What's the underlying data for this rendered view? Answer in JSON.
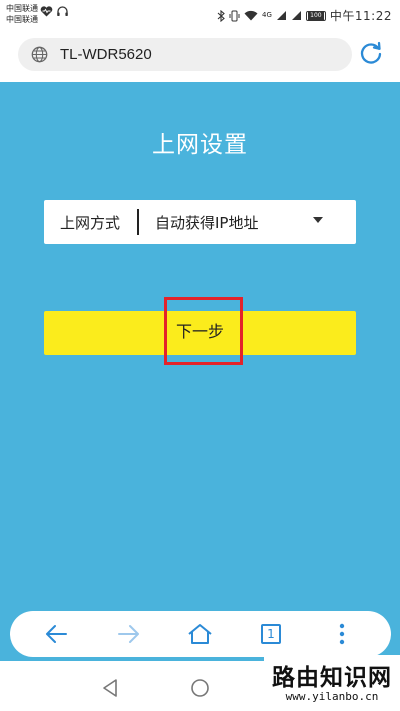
{
  "status_bar": {
    "carrier_1": "中国联通",
    "carrier_2": "中国联通",
    "network": "4G",
    "battery": "100",
    "time": "中午11:22"
  },
  "address_bar": {
    "url": "TL-WDR5620",
    "globe_icon": "globe-icon",
    "reload_icon": "reload-icon"
  },
  "page": {
    "title": "上网设置",
    "select_label": "上网方式",
    "select_value": "自动获得IP地址",
    "next_button": "下一步"
  },
  "toolbar": {
    "tab_count": "1",
    "icons": [
      "back-icon",
      "forward-icon",
      "home-icon",
      "tabs-icon",
      "more-icon"
    ]
  },
  "watermark": {
    "title": "路由知识网",
    "url": "www.yilanbo.cn"
  },
  "colors": {
    "background": "#4ab3dc",
    "button": "#fbec1c",
    "highlight": "#e3232a",
    "icon_blue": "#2b8ad6"
  }
}
